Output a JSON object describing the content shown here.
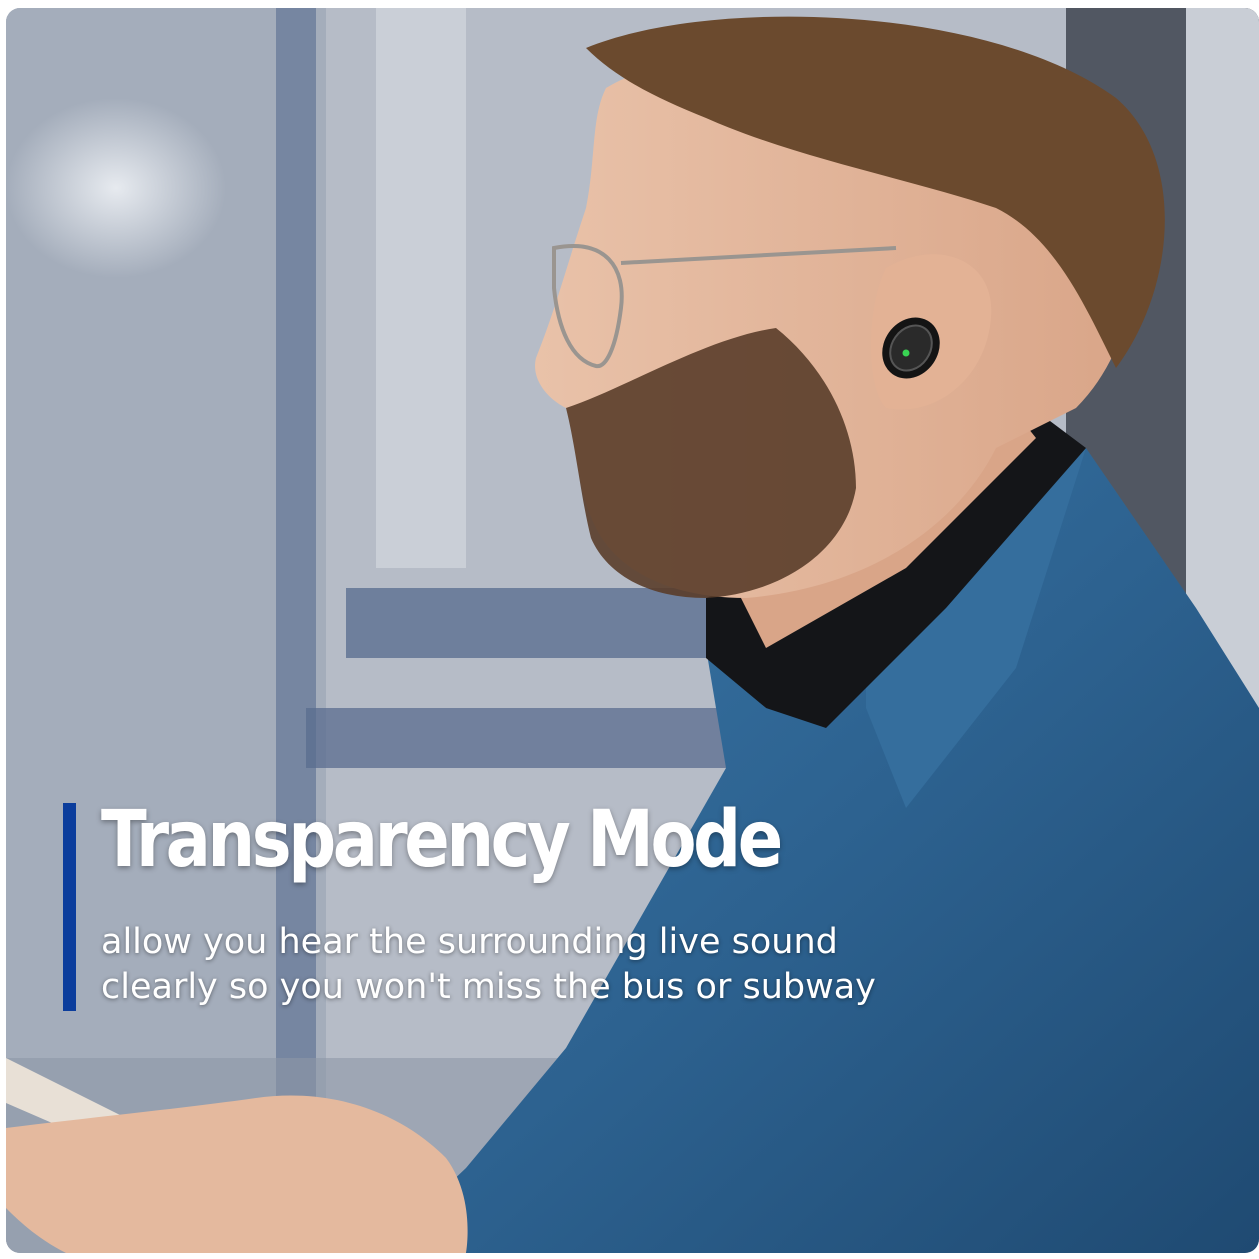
{
  "headline": "Transparency Mode",
  "subtitle": {
    "line1": "allow you  hear the surrounding live sound",
    "line2": "clearly so you won't miss the bus or subway"
  },
  "colors": {
    "accent_bar": "#0b3d9c",
    "coat": "#2d6290",
    "background": "#b3bac5",
    "earbud_led": "#39d353"
  },
  "icons": {
    "earbud": "earbud-icon"
  }
}
